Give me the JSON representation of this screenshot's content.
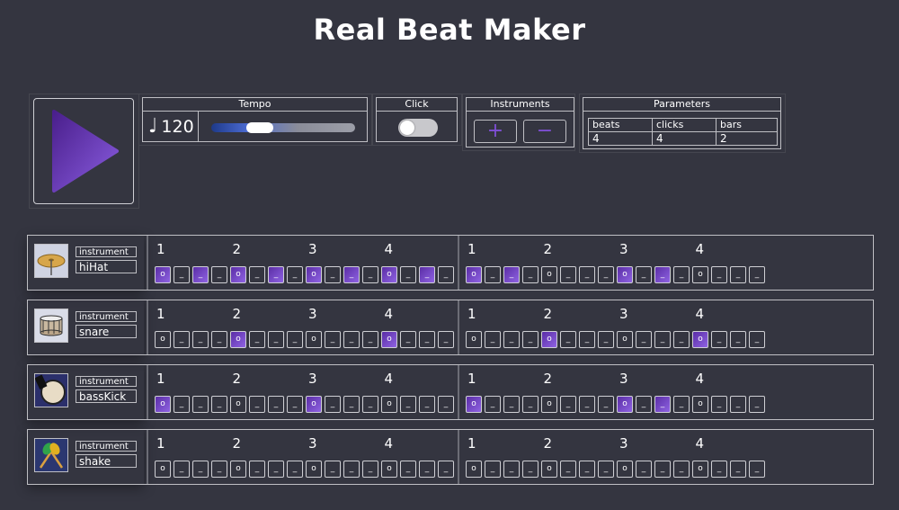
{
  "app": {
    "title": "Real Beat Maker"
  },
  "controls": {
    "tempo": {
      "label": "Tempo",
      "value": "120",
      "note_glyph": "♩",
      "slider_fraction": 0.3
    },
    "click": {
      "label": "Click",
      "enabled": false
    },
    "instruments": {
      "label": "Instruments",
      "add_label": "+",
      "remove_label": "−"
    },
    "parameters": {
      "label": "Parameters",
      "headers": [
        "beats",
        "clicks",
        "bars"
      ],
      "values": [
        "4",
        "4",
        "2"
      ]
    }
  },
  "grid": {
    "bar_numbers": [
      "1",
      "2",
      "3",
      "4"
    ],
    "beat_symbol": "o",
    "offbeat_symbol": "_"
  },
  "tracks": [
    {
      "label": "instrument",
      "name": "hiHat",
      "icon": "cymbal-icon",
      "bars": [
        [
          1,
          0,
          1,
          0,
          1,
          0,
          1,
          0,
          1,
          0,
          1,
          0,
          1,
          0,
          1,
          0
        ],
        [
          1,
          0,
          1,
          0,
          0,
          0,
          0,
          0,
          1,
          0,
          1,
          0,
          0,
          0,
          0,
          0
        ]
      ]
    },
    {
      "label": "instrument",
      "name": "snare",
      "icon": "snare-drum-icon",
      "bars": [
        [
          0,
          0,
          0,
          0,
          1,
          0,
          0,
          0,
          0,
          0,
          0,
          0,
          1,
          0,
          0,
          0
        ],
        [
          0,
          0,
          0,
          0,
          1,
          0,
          0,
          0,
          0,
          0,
          0,
          0,
          1,
          0,
          0,
          0
        ]
      ]
    },
    {
      "label": "instrument",
      "name": "bassKick",
      "icon": "bass-drum-icon",
      "bars": [
        [
          1,
          0,
          0,
          0,
          0,
          0,
          0,
          0,
          1,
          0,
          0,
          0,
          0,
          0,
          0,
          0
        ],
        [
          1,
          0,
          0,
          0,
          0,
          0,
          0,
          0,
          1,
          0,
          1,
          0,
          0,
          0,
          0,
          0
        ]
      ]
    },
    {
      "label": "instrument",
      "name": "shake",
      "icon": "maracas-icon",
      "bars": [
        [
          0,
          0,
          0,
          0,
          0,
          0,
          0,
          0,
          0,
          0,
          0,
          0,
          0,
          0,
          0,
          0
        ],
        [
          0,
          0,
          0,
          0,
          0,
          0,
          0,
          0,
          0,
          0,
          0,
          0,
          0,
          0,
          0,
          0
        ]
      ]
    }
  ],
  "colors": {
    "background": "#343540",
    "accent": "#7f4fd6",
    "border": "#bfbfc4"
  }
}
